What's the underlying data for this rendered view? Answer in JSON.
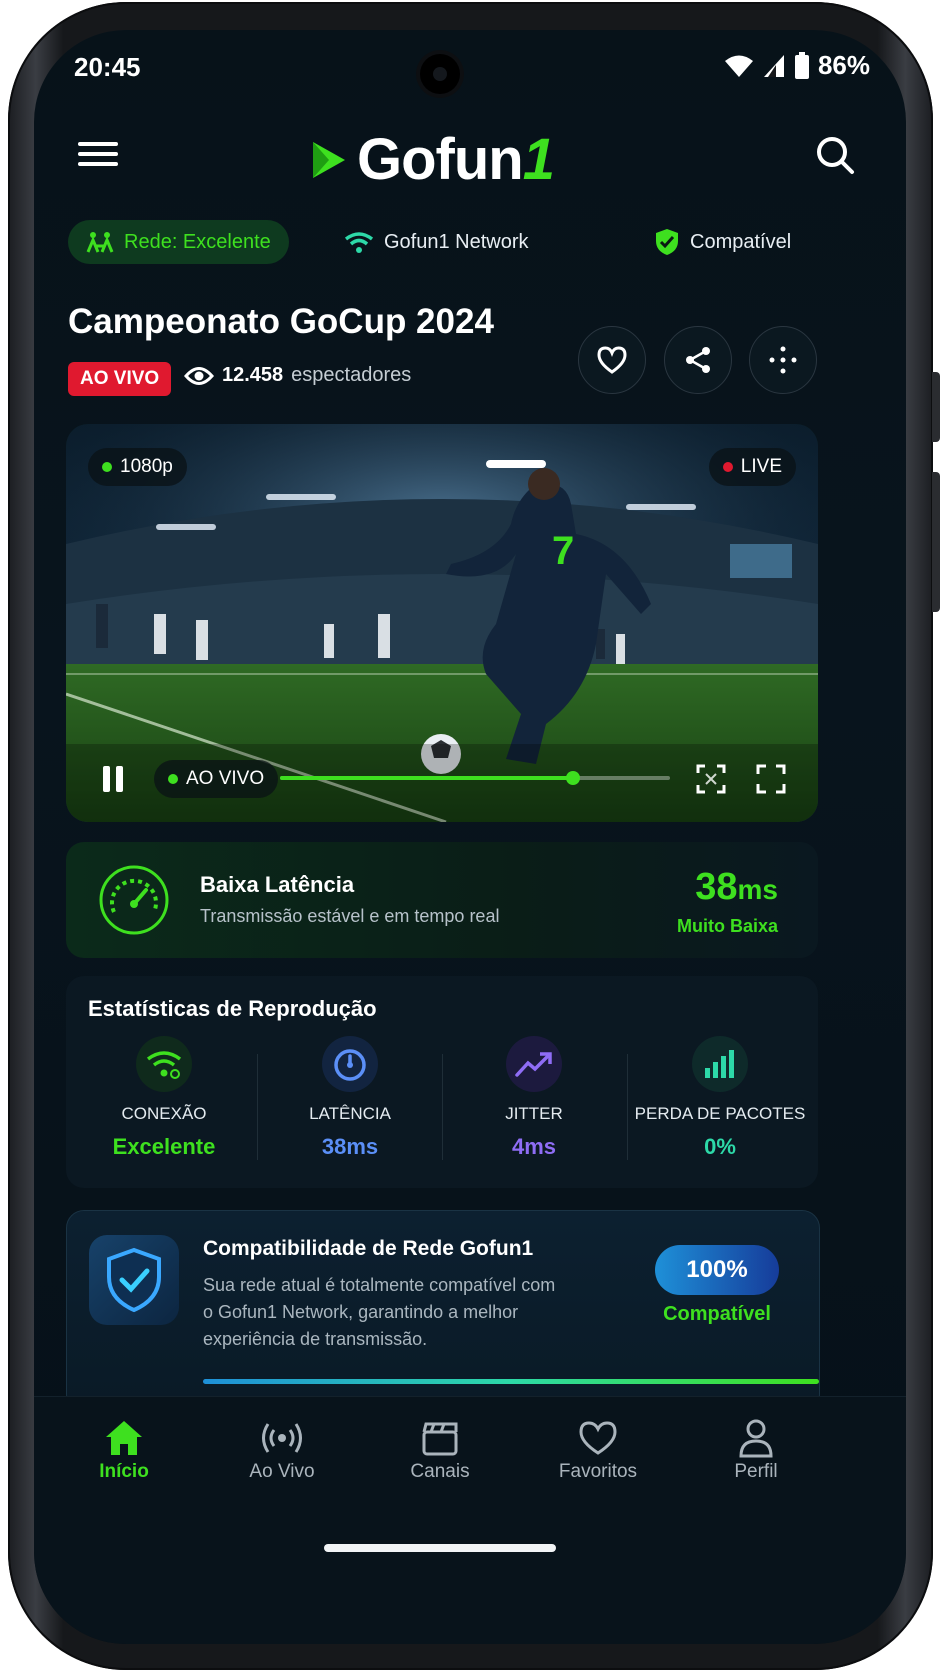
{
  "status_bar": {
    "time": "20:45",
    "battery": "86%"
  },
  "header": {
    "logo_main": "Gofun",
    "logo_num": "1"
  },
  "network_chips": {
    "rede": "Rede: Excelente",
    "network": "Gofun1 Network",
    "compat": "Compatível"
  },
  "event": {
    "title": "Campeonato GoCup 2024",
    "live_badge": "AO VIVO",
    "viewers_count": "12.458",
    "viewers_label": "espectadores"
  },
  "player": {
    "quality": "1080p",
    "live_tag": "LIVE",
    "live_status": "AO VIVO",
    "progress": 0.75,
    "jersey_number": "7"
  },
  "latency": {
    "title": "Baixa Latência",
    "subtitle": "Transmissão estável e em tempo real",
    "value": "38",
    "unit": "ms",
    "level": "Muito Baixa"
  },
  "stats": {
    "title": "Estatísticas de Reprodução",
    "items": [
      {
        "label": "CONEXÃO",
        "value": "Excelente",
        "color": "#3ee01f"
      },
      {
        "label": "LATÊNCIA",
        "value": "38ms",
        "color": "#5b8ff7"
      },
      {
        "label": "JITTER",
        "value": "4ms",
        "color": "#8f6df5"
      },
      {
        "label": "PERDA DE PACOTES",
        "value": "0%",
        "color": "#2dd9a8"
      }
    ]
  },
  "compat": {
    "title": "Compatibilidade de Rede Gofun1",
    "description_lines": [
      "Sua rede atual é totalmente compatível com",
      "o Gofun1 Network, garantindo a melhor",
      "experiência de transmissão."
    ],
    "percent": "100%",
    "status": "Compatível"
  },
  "nav": {
    "items": [
      {
        "label": "Início",
        "icon": "home-icon"
      },
      {
        "label": "Ao Vivo",
        "icon": "broadcast-icon"
      },
      {
        "label": "Canais",
        "icon": "clapper-icon"
      },
      {
        "label": "Favoritos",
        "icon": "heart-icon"
      },
      {
        "label": "Perfil",
        "icon": "user-icon"
      }
    ]
  },
  "colors": {
    "accent": "#3ee01f",
    "live": "#e0192f",
    "background": "#071219"
  }
}
